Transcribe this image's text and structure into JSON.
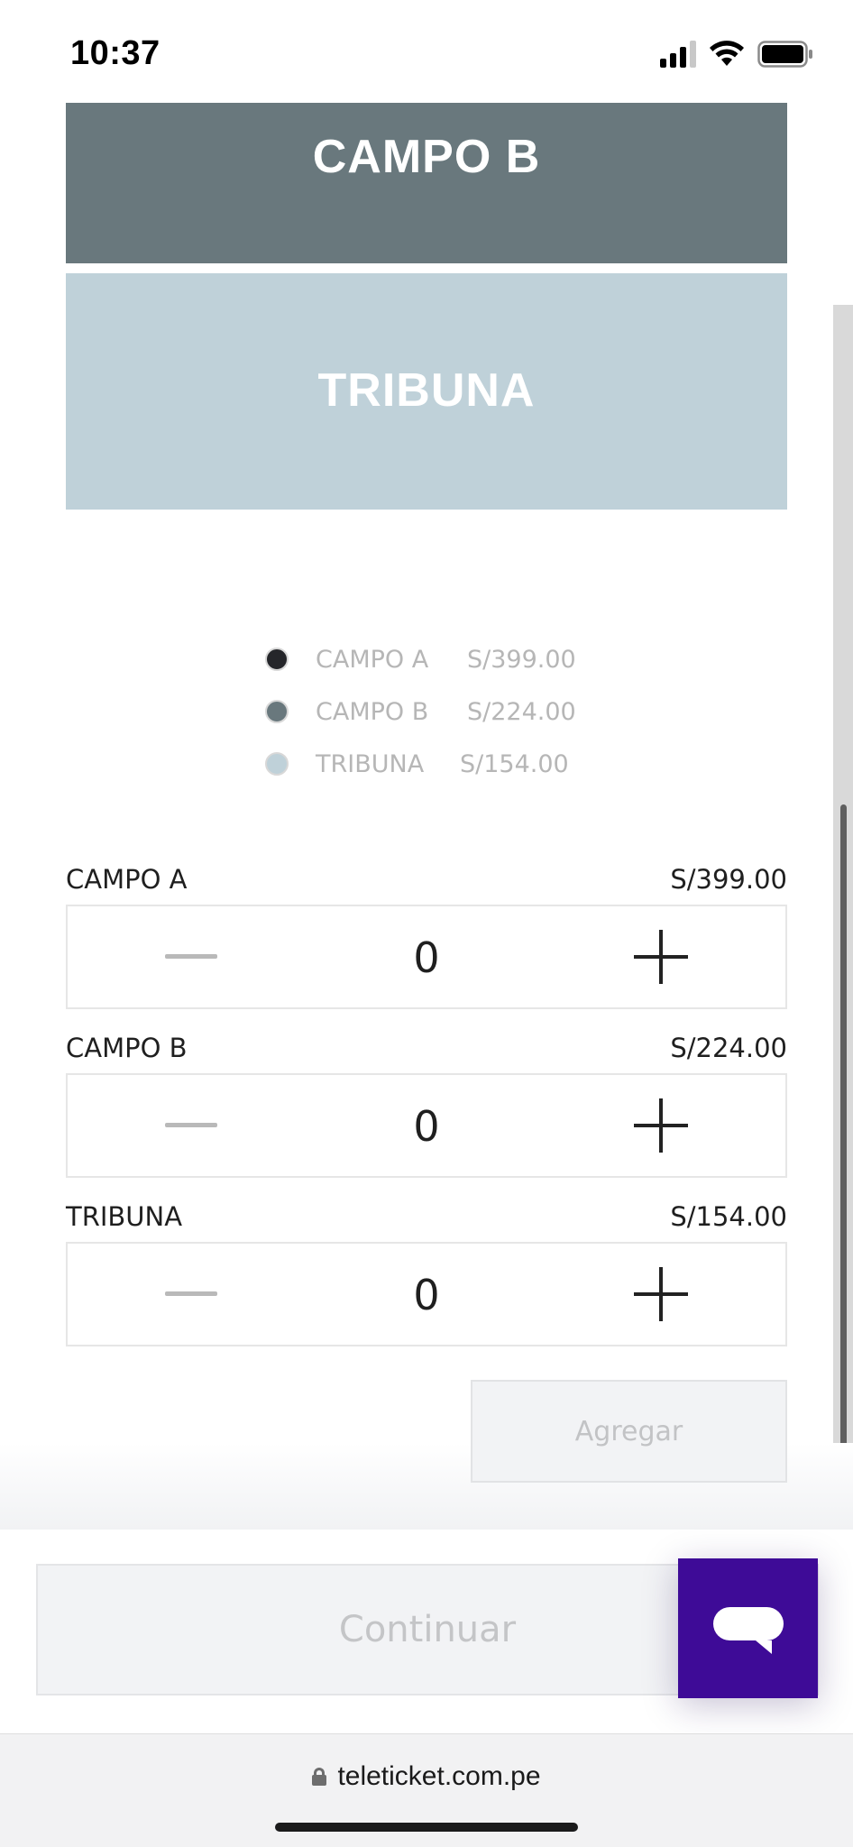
{
  "status_bar": {
    "time": "10:37"
  },
  "seat_map": {
    "zones": [
      {
        "label": "CAMPO B",
        "color": "#69787d"
      },
      {
        "label": "TRIBUNA",
        "color": "#bfd1d9"
      }
    ]
  },
  "legend": [
    {
      "name": "CAMPO A",
      "price": "S/399.00",
      "color": "#25262a"
    },
    {
      "name": "CAMPO B",
      "price": "S/224.00",
      "color": "#69787d"
    },
    {
      "name": "TRIBUNA",
      "price": "S/154.00",
      "color": "#bfd1d9"
    }
  ],
  "tickets": [
    {
      "name": "CAMPO A",
      "price": "S/399.00",
      "quantity": "0"
    },
    {
      "name": "CAMPO B",
      "price": "S/224.00",
      "quantity": "0"
    },
    {
      "name": "TRIBUNA",
      "price": "S/154.00",
      "quantity": "0"
    }
  ],
  "actions": {
    "add_label": "Agregar",
    "continue_label": "Continuar"
  },
  "icons": {
    "chat": "chat-bubble-icon",
    "lock": "lock-icon",
    "signal": "cellular-signal-icon",
    "wifi": "wifi-icon",
    "battery": "battery-icon",
    "minus": "minus-icon",
    "plus": "plus-icon"
  },
  "colors": {
    "accent": "#3e0b97"
  },
  "browser": {
    "url": "teleticket.com.pe"
  }
}
